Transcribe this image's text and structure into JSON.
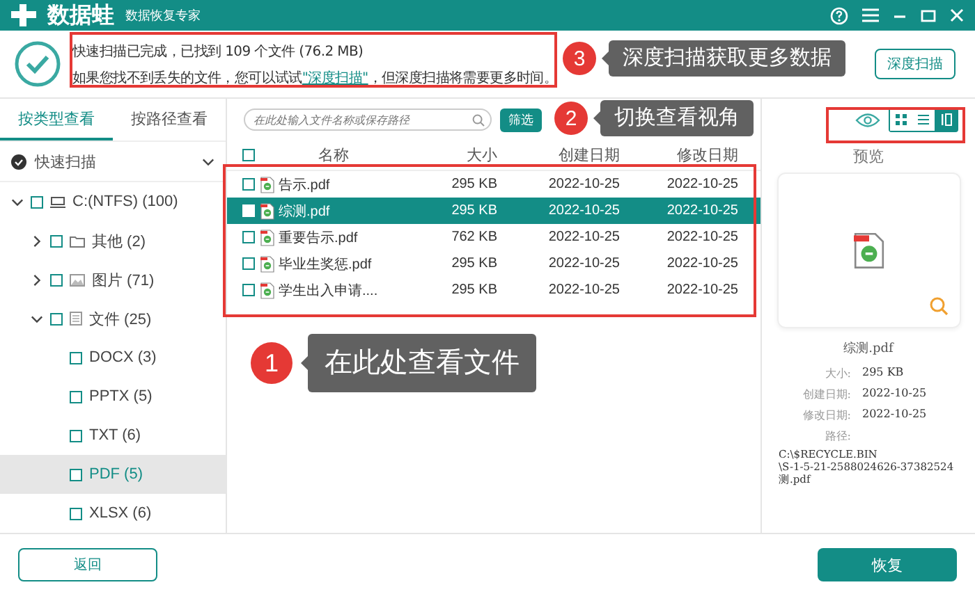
{
  "title_bar": {
    "logo": "数据蛙",
    "subtitle": "数据恢复专家"
  },
  "scan_summary": {
    "line_1": "快速扫描已完成，已找到 109 个文件 (76.2 MB)",
    "line_2_before": "如果您找不到丢失的文件，您可以试试",
    "link": "\"深度扫描\"",
    "line_2_after": "，但深度扫描将需要更多时间。",
    "deep_scan_button": "深度扫描"
  },
  "left_tabs": [
    {
      "label": "按类型查看",
      "selected": true
    },
    {
      "label": "按路径查看",
      "selected": false
    }
  ],
  "scan_mode": {
    "label": "快速扫描"
  },
  "tree": [
    {
      "label": "C:(NTFS) (100)",
      "kind": "drive",
      "expanded": true,
      "checked": false,
      "selected": false,
      "children": [
        {
          "label": "其他 (2)",
          "kind": "folder",
          "expanded": false,
          "checked": false,
          "selected": false
        },
        {
          "label": "图片 (71)",
          "kind": "image",
          "expanded": false,
          "checked": false,
          "selected": false
        },
        {
          "label": "文件 (25)",
          "kind": "document",
          "expanded": true,
          "checked": false,
          "selected": false,
          "children": [
            {
              "label": "DOCX (3)",
              "checked": false,
              "selected": false
            },
            {
              "label": "PPTX (5)",
              "checked": false,
              "selected": false
            },
            {
              "label": "TXT (6)",
              "checked": false,
              "selected": false
            },
            {
              "label": "PDF (5)",
              "checked": false,
              "selected": true
            },
            {
              "label": "XLSX (6)",
              "checked": false,
              "selected": false
            }
          ]
        }
      ]
    }
  ],
  "search": {
    "placeholder": "在此处输入文件名称或保存路径"
  },
  "filter_button": "筛选",
  "view_modes": [
    {
      "kind": "grid",
      "selected": false
    },
    {
      "kind": "list",
      "selected": false
    },
    {
      "kind": "columns",
      "selected": true
    }
  ],
  "table": {
    "all_checked": false,
    "columns": [
      "名称",
      "大小",
      "创建日期",
      "修改日期"
    ],
    "rows": [
      {
        "name": "告示.pdf",
        "size": "295 KB",
        "created": "2022-10-25",
        "modified": "2022-10-25",
        "checked": false,
        "selected": false
      },
      {
        "name": "综测.pdf",
        "size": "295 KB",
        "created": "2022-10-25",
        "modified": "2022-10-25",
        "checked": false,
        "selected": true
      },
      {
        "name": "重要告示.pdf",
        "size": "762 KB",
        "created": "2022-10-25",
        "modified": "2022-10-25",
        "checked": false,
        "selected": false
      },
      {
        "name": "毕业生奖惩.pdf",
        "size": "295 KB",
        "created": "2022-10-25",
        "modified": "2022-10-25",
        "checked": false,
        "selected": false
      },
      {
        "name": "学生出入申请....",
        "size": "295 KB",
        "created": "2022-10-25",
        "modified": "2022-10-25",
        "checked": false,
        "selected": false
      }
    ]
  },
  "preview": {
    "title": "预览",
    "file_name": "综测.pdf",
    "details": [
      {
        "label": "大小:",
        "value": "295 KB"
      },
      {
        "label": "创建日期:",
        "value": "2022-10-25"
      },
      {
        "label": "修改日期:",
        "value": "2022-10-25"
      },
      {
        "label": "路径:"
      }
    ],
    "path_lines": [
      "C:\\$RECYCLE.BIN",
      "\\S-1-5-21-2588024626-37382524",
      "测.pdf"
    ]
  },
  "bottom": {
    "back_button": "返回",
    "recover_button": "恢复"
  },
  "annotations": [
    {
      "number": "3",
      "text": "深度扫描获取更多数据"
    },
    {
      "number": "2",
      "text": "切换查看视角"
    },
    {
      "number": "1",
      "text": "在此处查看文件"
    }
  ]
}
